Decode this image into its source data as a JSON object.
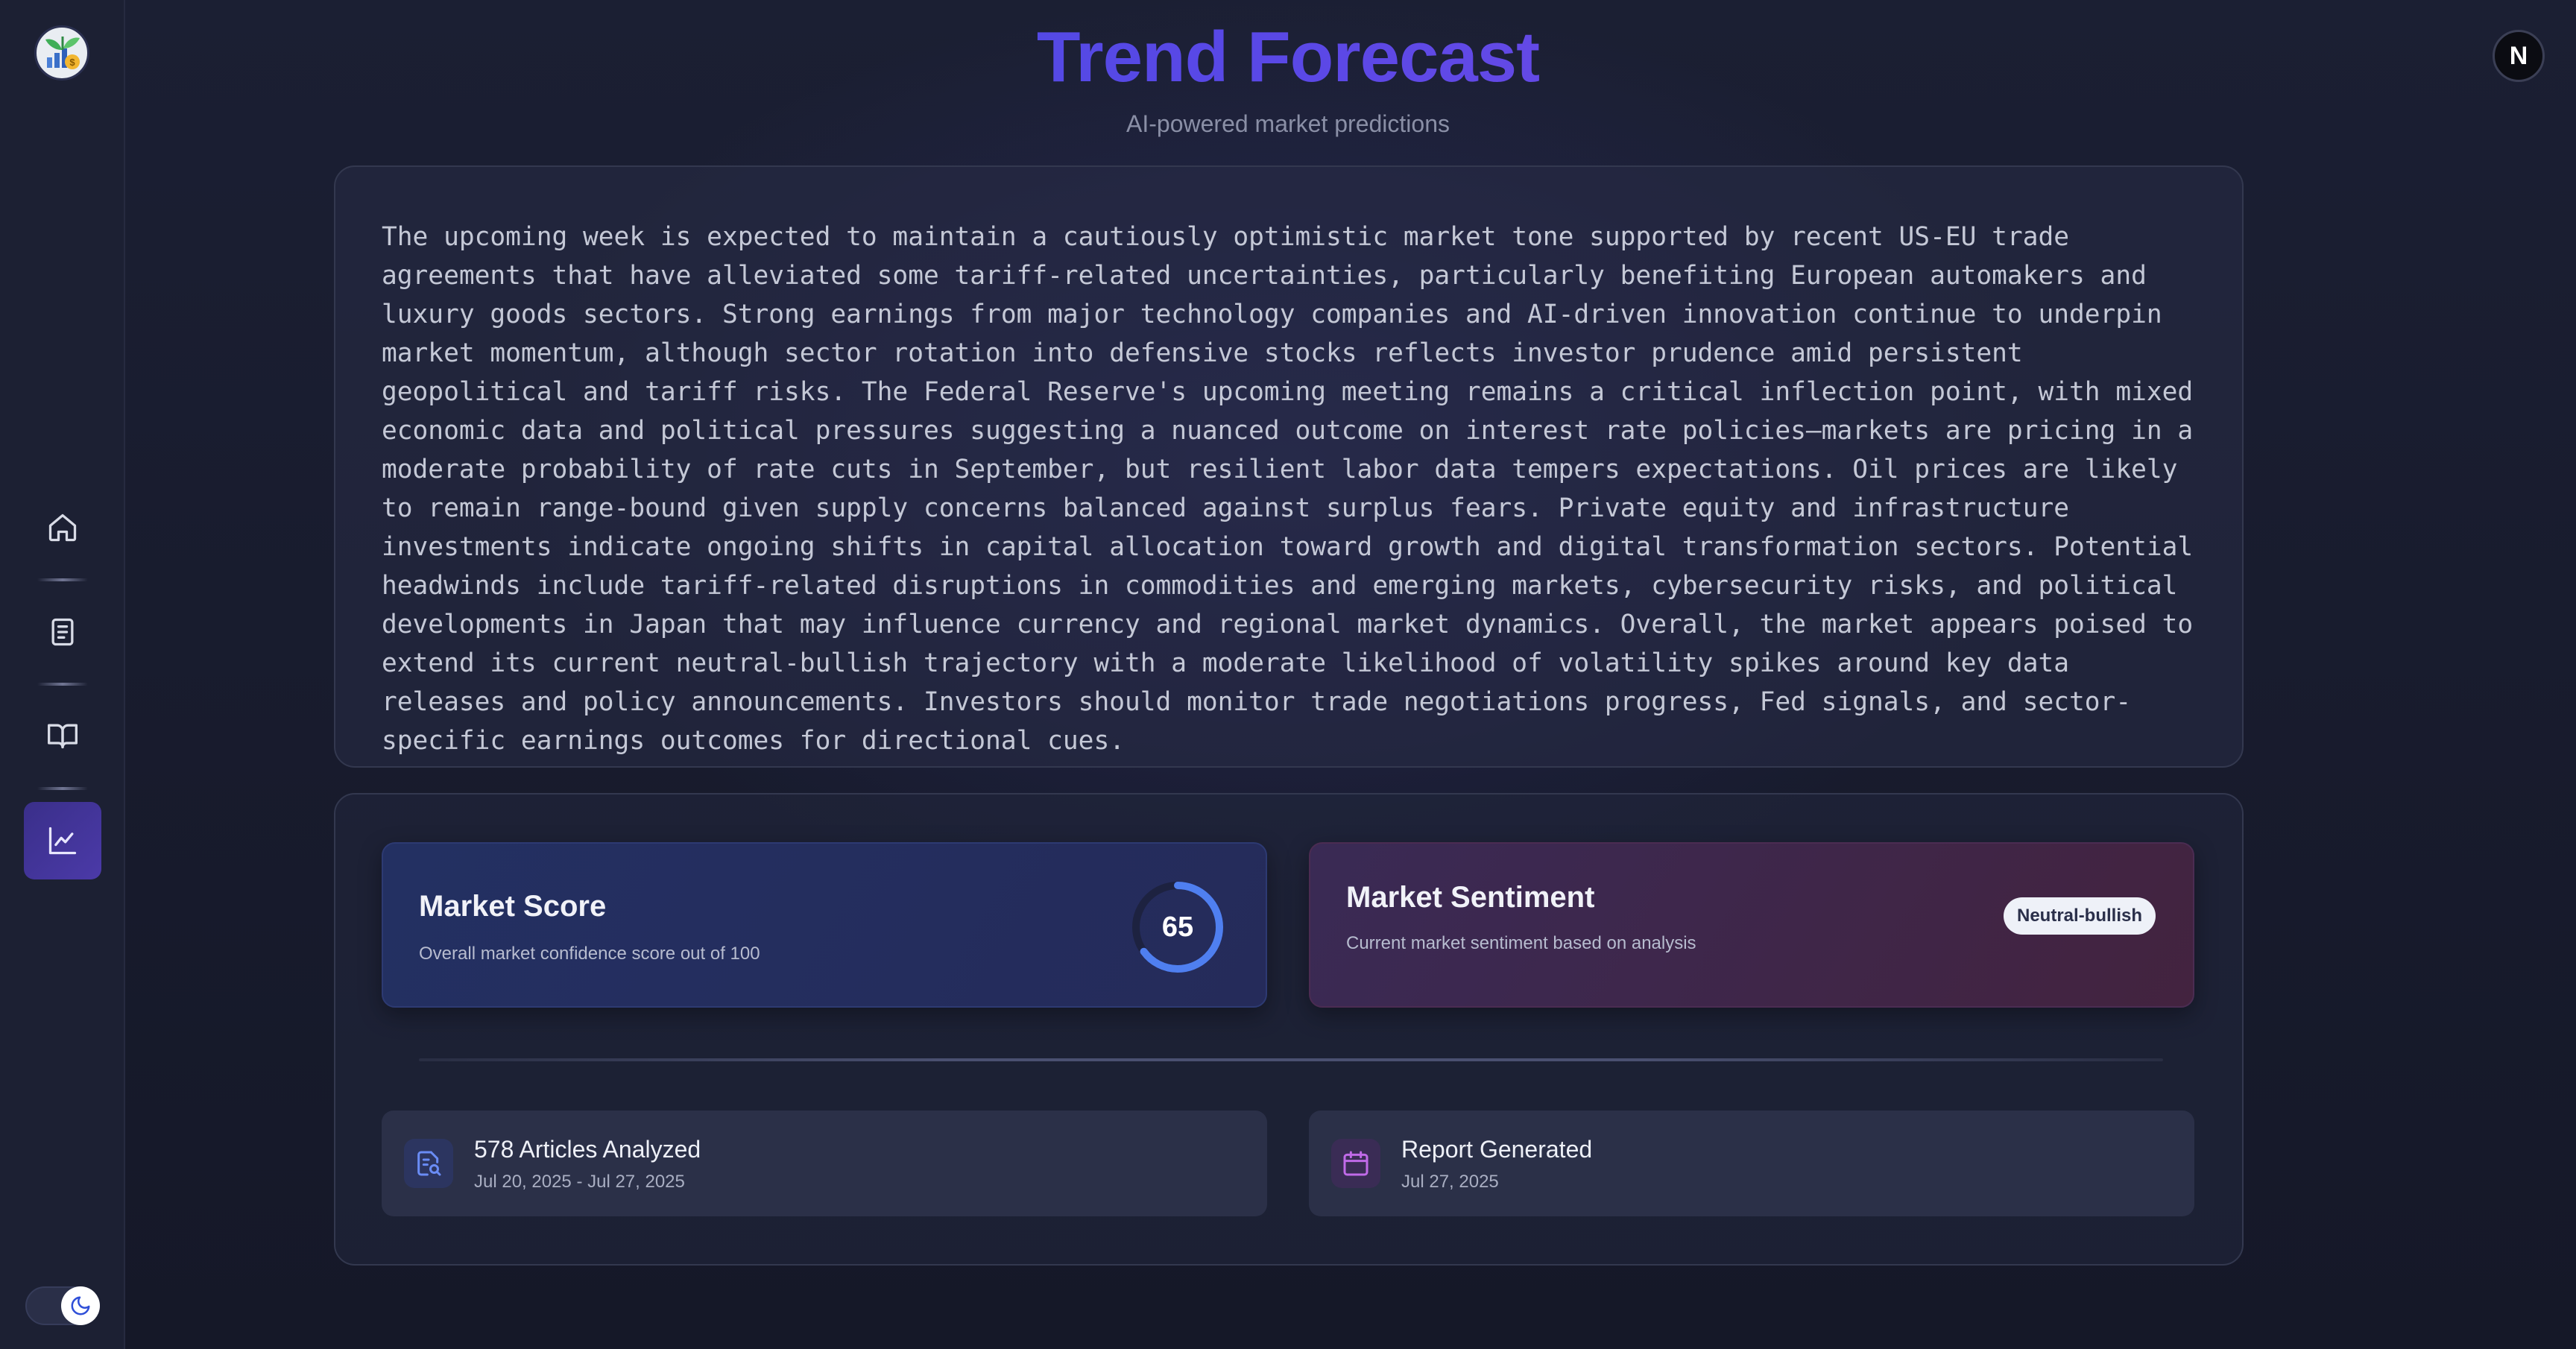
{
  "header": {
    "title": "Trend Forecast",
    "subtitle": "AI-powered market predictions"
  },
  "user": {
    "avatar_letter": "N"
  },
  "sidebar": {
    "items": [
      {
        "name": "home",
        "icon": "home-icon"
      },
      {
        "name": "reports",
        "icon": "document-icon"
      },
      {
        "name": "library",
        "icon": "book-open-icon"
      },
      {
        "name": "trends",
        "icon": "trend-chart-icon",
        "active": true
      }
    ],
    "theme": "dark"
  },
  "forecast": {
    "text": "The upcoming week is expected to maintain a cautiously optimistic market tone supported by recent US-EU trade agreements that have alleviated some tariff-related uncertainties, particularly benefiting European automakers and luxury goods sectors. Strong earnings from major technology companies and AI-driven innovation continue to underpin market momentum, although sector rotation into defensive stocks reflects investor prudence amid persistent geopolitical and tariff risks. The Federal Reserve's upcoming meeting remains a critical inflection point, with mixed economic data and political pressures suggesting a nuanced outcome on interest rate policies—markets are pricing in a moderate probability of rate cuts in September, but resilient labor data tempers expectations. Oil prices are likely to remain range-bound given supply concerns balanced against surplus fears. Private equity and infrastructure investments indicate ongoing shifts in capital allocation toward growth and digital transformation sectors. Potential headwinds include tariff-related disruptions in commodities and emerging markets, cybersecurity risks, and political developments in Japan that may influence currency and regional market dynamics. Overall, the market appears poised to extend its current neutral-bullish trajectory with a moderate likelihood of volatility spikes around key data releases and policy announcements. Investors should monitor trade negotiations progress, Fed signals, and sector-specific earnings outcomes for directional cues."
  },
  "market_score": {
    "title": "Market Score",
    "description": "Overall market confidence score out of 100",
    "value": "65",
    "max": 100
  },
  "market_sentiment": {
    "title": "Market Sentiment",
    "description": "Current market sentiment based on analysis",
    "badge": "Neutral-bullish"
  },
  "articles": {
    "title": "578 Articles Analyzed",
    "range": "Jul 20, 2025 - Jul 27, 2025",
    "icon": "document-search-icon"
  },
  "report": {
    "title": "Report Generated",
    "date": "Jul 27, 2025",
    "icon": "calendar-icon"
  },
  "colors": {
    "accent_blue": "#3d4de0",
    "accent_purple": "#8a4fe8",
    "gauge": "#4f7ff0"
  }
}
